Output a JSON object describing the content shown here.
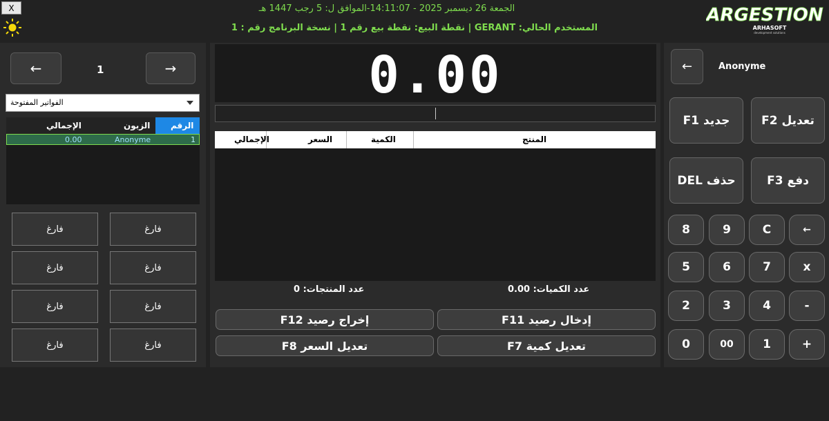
{
  "window": {
    "close_label": "X"
  },
  "header": {
    "datetime": "الجمعة 26 ديسمبر 2025 - 14:11:07-الموافق ل: 5 رجب 1447 هـ",
    "status": "المستخدم الحالي: GERANT | نقطة البيع: نقطة بيع رقم 1 | نسخة البرنامج رقم : 1"
  },
  "logo": {
    "brand": "ARGESTION",
    "sub": "ARHASOFT",
    "sub2": "development solutions"
  },
  "invoice_nav": {
    "prev_label": "←",
    "next_label": "→",
    "current_number": "1"
  },
  "invoice_select": {
    "selected": "الفواتير المفتوحة"
  },
  "invoices_table": {
    "headers": [
      "الرقم",
      "الزبون",
      "الإجمالي"
    ],
    "rows": [
      {
        "number": "1",
        "customer": "Anonyme",
        "total": "0.00"
      }
    ]
  },
  "slots": [
    "فارغ",
    "فارغ",
    "فارغ",
    "فارغ",
    "فارغ",
    "فارغ",
    "فارغ",
    "فارغ"
  ],
  "display": {
    "total": "0.00"
  },
  "products_table": {
    "headers": [
      "المنتج",
      "الكمية",
      "السعر",
      "الإجمالي"
    ]
  },
  "counts": {
    "quantities": "عدد الكميات: 0.00",
    "products": "عدد المنتجات: 0"
  },
  "actions": {
    "balance_in": "إدخال رصيد F11",
    "balance_out": "إخراج رصيد F12",
    "edit_qty": "تعديل كمية F7",
    "edit_price": "تعديل السعر F8"
  },
  "customer": {
    "back_label": "←",
    "name": "Anonyme"
  },
  "fkeys": {
    "new": "جديد F1",
    "edit": "تعديل F2",
    "delete": "حذف DEL",
    "pay": "دفع F3"
  },
  "keypad": {
    "row1": [
      "8",
      "9",
      "C",
      "←"
    ],
    "row2": [
      "5",
      "6",
      "7",
      "x"
    ],
    "row3": [
      "2",
      "3",
      "4",
      "-"
    ],
    "row4": [
      "0",
      "00",
      "1",
      "+"
    ]
  },
  "colors": {
    "accent_green": "#7fdc4e",
    "table_header_blue": "#1e88e5",
    "row_selected": "#2e6b4a"
  }
}
